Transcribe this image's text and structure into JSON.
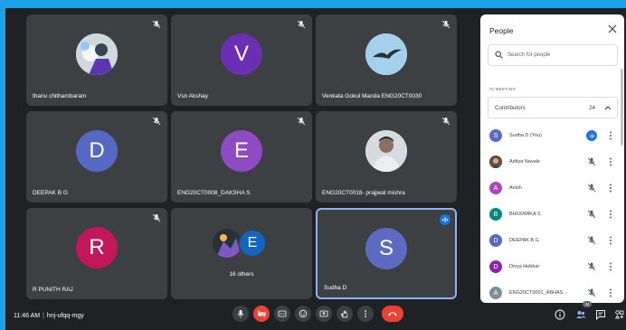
{
  "tiles": [
    {
      "name": "thanu chithambaram"
    },
    {
      "name": "Vsn Akshay",
      "letter": "V"
    },
    {
      "name": "Venkata Gokul Manda ENG20CT0030"
    },
    {
      "name": "DEEPAK B G",
      "letter": "D"
    },
    {
      "name": "ENG20CT0008_DAKSHA S",
      "letter": "E"
    },
    {
      "name": "ENG20CT0018- prajjwal mishra"
    },
    {
      "name": "R PUNITH RAJ",
      "letter": "R"
    },
    {
      "others_letter": "E",
      "others_count": "16 others"
    },
    {
      "name": "Sudha D",
      "letter": "S"
    }
  ],
  "panel": {
    "title": "People",
    "search_placeholder": "Search for people",
    "section_label": "IN MEETING",
    "contributors_label": "Contributors",
    "contributors_count": "24",
    "people": [
      {
        "name": "Sudha D (You)",
        "letter": "S"
      },
      {
        "name": "Aditya Navale"
      },
      {
        "name": "Anish",
        "letter": "A"
      },
      {
        "name": "BHOOMIKA S",
        "letter": "B"
      },
      {
        "name": "DEEPAK B G",
        "letter": "D"
      },
      {
        "name": "Divya Hebbar",
        "letter": "D"
      },
      {
        "name": "ENG20CT0001_ABHAS...",
        "letter": "A"
      }
    ]
  },
  "bottom": {
    "time": "11:46 AM",
    "meeting_code": "hnj-ufqq-mgy",
    "people_badge": "24"
  },
  "colors": {
    "v_avatar": "#6b2fb3",
    "d_avatar": "#5468c4",
    "e_avatar": "#8e4bc4",
    "r_avatar": "#c2185b",
    "s_avatar": "#5c6bc0",
    "end_call": "#ea4335",
    "active_border": "#8ab4f8",
    "speaking": "#1a73e8"
  },
  "icons": [
    "mic-off-icon",
    "mic-icon",
    "camera-off-icon",
    "captions-icon",
    "emoji-icon",
    "present-icon",
    "raise-hand-icon",
    "more-vert-icon",
    "end-call-icon",
    "info-icon",
    "people-icon",
    "chat-icon",
    "activities-icon",
    "search-icon",
    "close-icon",
    "chevron-up-icon",
    "speaking-icon"
  ]
}
